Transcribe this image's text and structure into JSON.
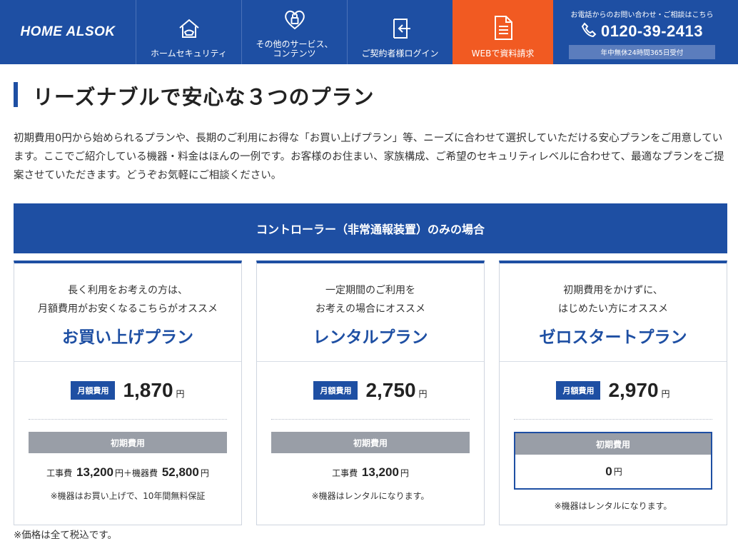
{
  "header": {
    "logo_text": "HOME ALSOK",
    "nav": [
      {
        "label": "ホームセキュリティ",
        "icon": "house-icon"
      },
      {
        "label": "その他のサービス、\nコンテンツ",
        "icon": "heart-lock-icon"
      },
      {
        "label": "ご契約者様ログイン",
        "icon": "login-door-icon"
      },
      {
        "label": "WEBで資料請求",
        "icon": "document-icon"
      }
    ],
    "contact": {
      "note": "お電話からのお問い合わせ・ご相談はこちら",
      "phone": "0120-39-2413",
      "hours": "年中無休24時間365日受付"
    }
  },
  "page": {
    "title": "リーズナブルで安心な３つのプラン",
    "intro": "初期費用0円から始められるプランや、長期のご利用にお得な「お買い上げプラン」等、ニーズに合わせて選択していただける安心プランをご用意しています。ここでご紹介している機器・料金はほんの一例です。お客様のお住まい、家族構成、ご希望のセキュリティレベルに合わせて、最適なプランをご提案させていただきます。どうぞお気軽にご相談ください。",
    "band_title": "コントローラー（非常通報装置）のみの場合",
    "footnote": "※価格は全て税込です。"
  },
  "plans": [
    {
      "tagline": "長く利用をお考えの方は、\n月額費用がお安くなるこちらがオススメ",
      "name": "お買い上げプラン",
      "price_label": "月額費用",
      "price": "1,870",
      "unit": "円",
      "initial_label": "初期費用",
      "fee1_label": "工事費",
      "fee1_value": "13,200",
      "fee1_unit": "円＋",
      "fee2_label": "機器費",
      "fee2_value": "52,800",
      "fee2_unit": "円",
      "note": "※機器はお買い上げで、10年間無料保証"
    },
    {
      "tagline": "一定期間のご利用を\nお考えの場合にオススメ",
      "name": "レンタルプラン",
      "price_label": "月額費用",
      "price": "2,750",
      "unit": "円",
      "initial_label": "初期費用",
      "fee1_label": "工事費",
      "fee1_value": "13,200",
      "fee1_unit": "円",
      "note": "※機器はレンタルになります。"
    },
    {
      "tagline": "初期費用をかけずに、\nはじめたい方にオススメ",
      "name": "ゼロスタートプラン",
      "price_label": "月額費用",
      "price": "2,970",
      "unit": "円",
      "initial_label": "初期費用",
      "fee_value": "0",
      "fee_unit": "円",
      "note": "※機器はレンタルになります。"
    }
  ],
  "colors": {
    "brand_blue": "#1e4fa3",
    "cta_orange": "#f15a22",
    "gray_head": "#999ea7"
  }
}
